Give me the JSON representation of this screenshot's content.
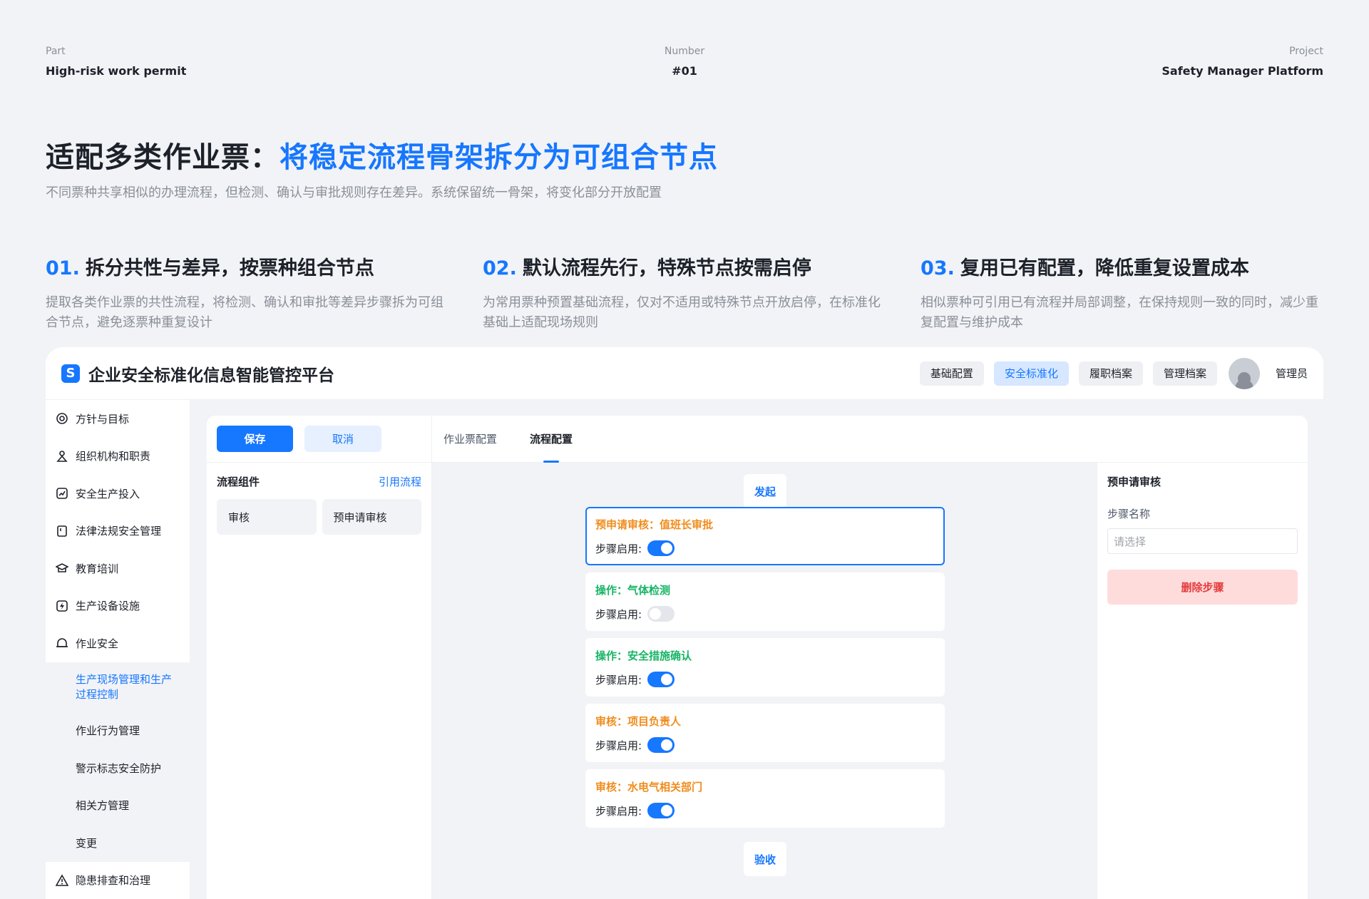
{
  "meta": {
    "part_key": "Part",
    "part_val": "High-risk work permit",
    "num_key": "Number",
    "num_val": "#01",
    "proj_key": "Project",
    "proj_val": "Safety Manager Platform"
  },
  "headline": {
    "prefix": "适配多类作业票：",
    "highlight": "将稳定流程骨架拆分为可组合节点"
  },
  "subline": "不同票种共享相似的办理流程，但检测、确认与审批规则存在差异。系统保留统一骨架，将变化部分开放配置",
  "features": [
    {
      "num": "01.",
      "title": "拆分共性与差异，按票种组合节点",
      "desc": "提取各类作业票的共性流程，将检测、确认和审批等差异步骤拆为可组合节点，避免逐票种重复设计"
    },
    {
      "num": "02.",
      "title": "默认流程先行，特殊节点按需启停",
      "desc": "为常用票种预置基础流程，仅对不适用或特殊节点开放启停，在标准化基础上适配现场规则"
    },
    {
      "num": "03.",
      "title": "复用已有配置，降低重复设置成本",
      "desc": "相似票种可引用已有流程并局部调整，在保持规则一致的同时，减少重复配置与维护成本"
    }
  ],
  "app": {
    "logo": "S",
    "title": "企业安全标准化信息智能管控平台",
    "nav": [
      "基础配置",
      "安全标准化",
      "履职档案",
      "管理档案"
    ],
    "nav_active": 1,
    "user": "管理员"
  },
  "sidebar": {
    "items": [
      {
        "label": "方针与目标",
        "icon": "target-icon"
      },
      {
        "label": "组织机构和职责",
        "icon": "org-icon"
      },
      {
        "label": "安全生产投入",
        "icon": "chart-icon"
      },
      {
        "label": "法律法规安全管理",
        "icon": "book-icon"
      },
      {
        "label": "教育培训",
        "icon": "graduation-icon"
      },
      {
        "label": "生产设备设施",
        "icon": "device-icon"
      },
      {
        "label": "作业安全",
        "icon": "helmet-icon"
      }
    ],
    "sub_items": [
      "生产现场管理和生产过程控制",
      "作业行为管理",
      "警示标志安全防护",
      "相关方管理",
      "变更"
    ],
    "last_item": {
      "label": "隐患排查和治理",
      "icon": "warning-icon"
    }
  },
  "toolbar": {
    "save": "保存",
    "cancel": "取消"
  },
  "components": {
    "title": "流程组件",
    "action": "引用流程",
    "items": [
      "审核",
      "预申请审核"
    ]
  },
  "tabs": [
    "作业票配置",
    "流程配置"
  ],
  "flow": {
    "start": "发起",
    "end": "验收",
    "toggle_label": "步骤启用:",
    "steps": [
      {
        "title": "预申请审核：值班长审批",
        "kind": "review",
        "enabled": true,
        "selected": true
      },
      {
        "title": "操作：气体检测",
        "kind": "op",
        "enabled": false,
        "selected": false
      },
      {
        "title": "操作：安全措施确认",
        "kind": "op",
        "enabled": true,
        "selected": false
      },
      {
        "title": "审核：项目负责人",
        "kind": "review",
        "enabled": true,
        "selected": false
      },
      {
        "title": "审核：水电气相关部门",
        "kind": "review",
        "enabled": true,
        "selected": false
      }
    ]
  },
  "panel": {
    "title": "预申请审核",
    "label": "步骤名称",
    "placeholder": "请选择",
    "delete": "删除步骤"
  },
  "colors": {
    "accent": "#1677ff",
    "review": "#f08c1c",
    "op": "#18b566",
    "danger": "#e43b3b"
  }
}
